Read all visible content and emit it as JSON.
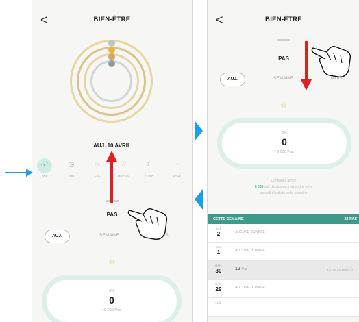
{
  "screen1": {
    "back": "<",
    "title": "BIEN-ÊTRE",
    "date": "AUJ. 10 AVRIL",
    "metrics": [
      {
        "icon": "☍",
        "value": "-",
        "label": "PAS"
      },
      {
        "icon": "◷",
        "value": "-",
        "label": "MIN"
      },
      {
        "icon": "♨",
        "value": "-",
        "label": "CAL"
      },
      {
        "icon": "♡",
        "value": "-",
        "label": "REPOS"
      },
      {
        "icon": "☾",
        "value": "-:-",
        "label": "H MIN"
      },
      {
        "icon": "◔",
        "value": "-",
        "label": "SPO2"
      }
    ],
    "sheet": {
      "title": "PAS",
      "tabs": [
        "AUJ.",
        "SEMAINE",
        "MOIS"
      ],
      "star": "☆",
      "percent": "0%",
      "value": "0",
      "goal": "/ 6 000 Pas"
    }
  },
  "screen2": {
    "back": "<",
    "title": "BIEN-ÊTRE",
    "sheet": {
      "title": "PAS",
      "tabs": [
        "AUJ.",
        "SEMAINE",
        "MOIS"
      ],
      "star": "☆",
      "percent": "0%",
      "value": "0",
      "goal": "/ 6 000 Pas",
      "msg_line1": "Continuez ainsi !",
      "msg_highlight": "6 000",
      "msg_line2": "pas de plus pour atteindre votre",
      "msg_line3": "objectif d'activité cette semaine"
    },
    "week": {
      "title": "CETTE SEMAINE",
      "total": "24 PAS",
      "rows": [
        {
          "day": "AUJ.",
          "num": "2",
          "text": "AUCUNE DONNÉE"
        },
        {
          "day": "JEU.",
          "num": "1",
          "text": "AUCUNE DONNÉE"
        },
        {
          "day": "MER.",
          "num": "30",
          "value": "12",
          "unit": "Pas",
          "km": "0,0 KM ESTIMÉ(S)"
        },
        {
          "day": "MAR.",
          "num": "29",
          "text": "AUCUNE DONNÉE"
        },
        {
          "day": "LUN.",
          "num": "",
          "text": ""
        }
      ]
    }
  },
  "colors": {
    "accent": "#3cb39a",
    "ring_outer": "#e8cf8f",
    "ring_mid": "#d9b777",
    "ring_inner": "#cfd0d0",
    "arrow_red": "#e02020",
    "arrow_blue": "#1aa0e6",
    "star": "#e8b93a"
  },
  "icons": {
    "back": "chevron-left-icon",
    "hand": "pointing-hand-icon",
    "star": "star-outline-icon"
  }
}
